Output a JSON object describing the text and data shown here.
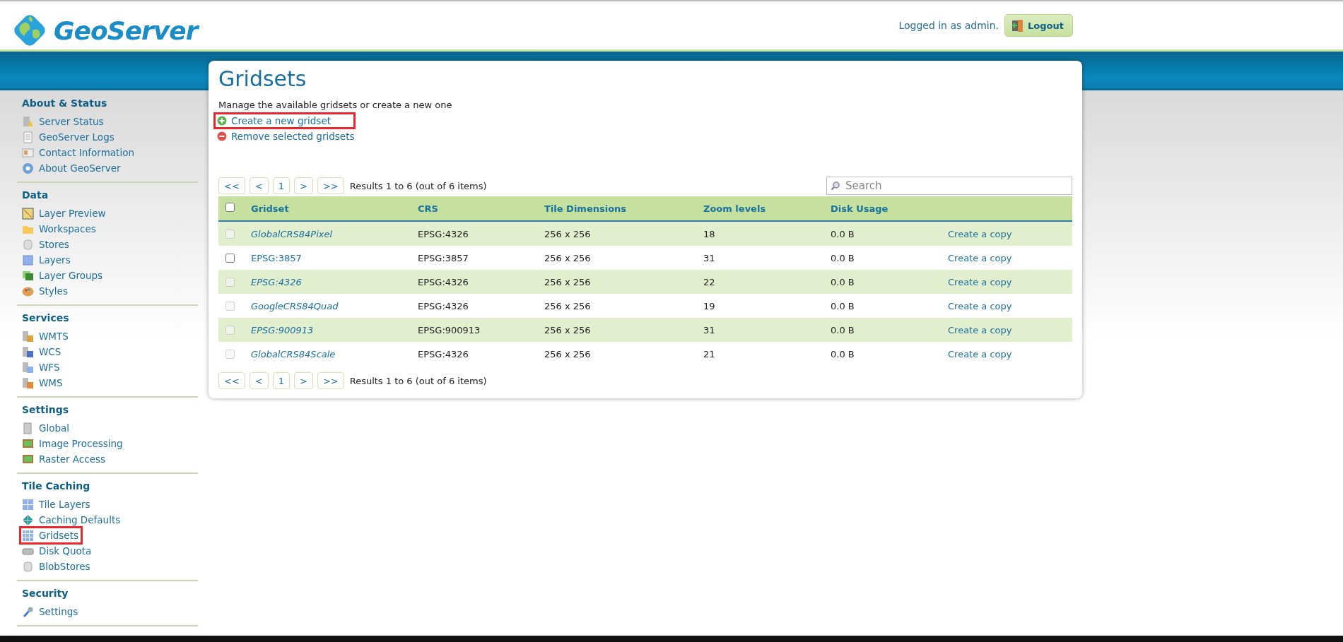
{
  "header": {
    "logo": "GeoServer",
    "login_text": "Logged in as admin.",
    "logout_button": "Logout"
  },
  "sidebar": [
    {
      "heading": "About & Status",
      "items": [
        {
          "label": "Server Status",
          "highlighted": false
        },
        {
          "label": "GeoServer Logs",
          "highlighted": false
        },
        {
          "label": "Contact Information",
          "highlighted": false
        },
        {
          "label": "About GeoServer",
          "highlighted": false
        }
      ]
    },
    {
      "heading": "Data",
      "items": [
        {
          "label": "Layer Preview",
          "highlighted": false
        },
        {
          "label": "Workspaces",
          "highlighted": false
        },
        {
          "label": "Stores",
          "highlighted": false
        },
        {
          "label": "Layers",
          "highlighted": false
        },
        {
          "label": "Layer Groups",
          "highlighted": false
        },
        {
          "label": "Styles",
          "highlighted": false
        }
      ]
    },
    {
      "heading": "Services",
      "items": [
        {
          "label": "WMTS",
          "highlighted": false
        },
        {
          "label": "WCS",
          "highlighted": false
        },
        {
          "label": "WFS",
          "highlighted": false
        },
        {
          "label": "WMS",
          "highlighted": false
        }
      ]
    },
    {
      "heading": "Settings",
      "items": [
        {
          "label": "Global",
          "highlighted": false
        },
        {
          "label": "Image Processing",
          "highlighted": false
        },
        {
          "label": "Raster Access",
          "highlighted": false
        }
      ]
    },
    {
      "heading": "Tile Caching",
      "items": [
        {
          "label": "Tile Layers",
          "highlighted": false
        },
        {
          "label": "Caching Defaults",
          "highlighted": false
        },
        {
          "label": "Gridsets",
          "highlighted": true
        },
        {
          "label": "Disk Quota",
          "highlighted": false
        },
        {
          "label": "BlobStores",
          "highlighted": false
        }
      ]
    },
    {
      "heading": "Security",
      "items": [
        {
          "label": "Settings",
          "highlighted": false
        }
      ]
    }
  ],
  "page": {
    "title": "Gridsets",
    "description": "Manage the available gridsets or create a new one",
    "actions": [
      {
        "label": "Create a new gridset",
        "kind": "add",
        "highlighted": true
      },
      {
        "label": "Remove selected gridsets",
        "kind": "remove",
        "highlighted": false
      }
    ],
    "pager": {
      "buttons": [
        "<<",
        "<",
        "1",
        ">",
        ">>"
      ],
      "summary": "Results 1 to 6 (out of 6 items)"
    },
    "search": {
      "placeholder": "Search"
    },
    "table": {
      "select_all": {
        "checked": false
      },
      "columns": [
        "Gridset",
        "CRS",
        "Tile Dimensions",
        "Zoom levels",
        "Disk Usage"
      ],
      "rows": [
        {
          "gridset": "GlobalCRS84Pixel",
          "crs": "EPSG:4326",
          "tile_dimensions": "256 x 256",
          "zoom_levels": "18",
          "disk_usage": "0.0 B",
          "action": "Create a copy",
          "disabled": true
        },
        {
          "gridset": "EPSG:3857",
          "crs": "EPSG:3857",
          "tile_dimensions": "256 x 256",
          "zoom_levels": "31",
          "disk_usage": "0.0 B",
          "action": "Create a copy",
          "disabled": false
        },
        {
          "gridset": "EPSG:4326",
          "crs": "EPSG:4326",
          "tile_dimensions": "256 x 256",
          "zoom_levels": "22",
          "disk_usage": "0.0 B",
          "action": "Create a copy",
          "disabled": true
        },
        {
          "gridset": "GoogleCRS84Quad",
          "crs": "EPSG:4326",
          "tile_dimensions": "256 x 256",
          "zoom_levels": "19",
          "disk_usage": "0.0 B",
          "action": "Create a copy",
          "disabled": true
        },
        {
          "gridset": "EPSG:900913",
          "crs": "EPSG:900913",
          "tile_dimensions": "256 x 256",
          "zoom_levels": "31",
          "disk_usage": "0.0 B",
          "action": "Create a copy",
          "disabled": true
        },
        {
          "gridset": "GlobalCRS84Scale",
          "crs": "EPSG:4326",
          "tile_dimensions": "256 x 256",
          "zoom_levels": "21",
          "disk_usage": "0.0 B",
          "action": "Create a copy",
          "disabled": true
        }
      ]
    },
    "bottom_pager": {
      "buttons": [
        "<<",
        "<",
        "1",
        ">",
        ">>"
      ],
      "summary": "Results 1 to 6 (out of 6 items)"
    }
  }
}
